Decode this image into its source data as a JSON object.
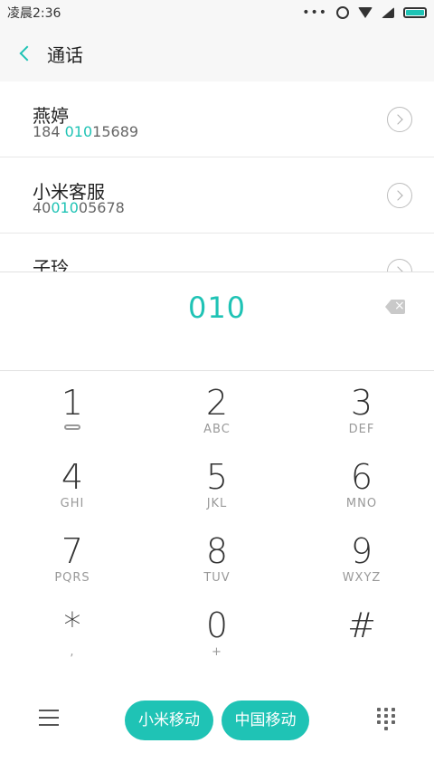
{
  "status": {
    "time": "凌晨2:36",
    "dots": "•••"
  },
  "header": {
    "title": "通话"
  },
  "contacts": [
    {
      "name": "燕婷",
      "number_prefix": "184 ",
      "number_match": "010",
      "number_suffix": "15689"
    },
    {
      "name": "小米客服",
      "number_prefix": "40",
      "number_match": "010",
      "number_suffix": "05678"
    },
    {
      "name": "子玲",
      "number_prefix": "",
      "number_match": "",
      "number_suffix": ""
    }
  ],
  "dialer": {
    "input": "010",
    "backspace_symbol": "×"
  },
  "keypad": [
    {
      "num": "1",
      "sub": ""
    },
    {
      "num": "2",
      "sub": "ABC"
    },
    {
      "num": "3",
      "sub": "DEF"
    },
    {
      "num": "4",
      "sub": "GHI"
    },
    {
      "num": "5",
      "sub": "JKL"
    },
    {
      "num": "6",
      "sub": "MNO"
    },
    {
      "num": "7",
      "sub": "PQRS"
    },
    {
      "num": "8",
      "sub": "TUV"
    },
    {
      "num": "9",
      "sub": "WXYZ"
    },
    {
      "num": "*",
      "sub": ","
    },
    {
      "num": "0",
      "sub": "+"
    },
    {
      "num": "#",
      "sub": ""
    }
  ],
  "bottom": {
    "sim1_label": "小米移动",
    "sim2_label": "中国移动"
  },
  "colors": {
    "accent": "#1fc3b5"
  }
}
